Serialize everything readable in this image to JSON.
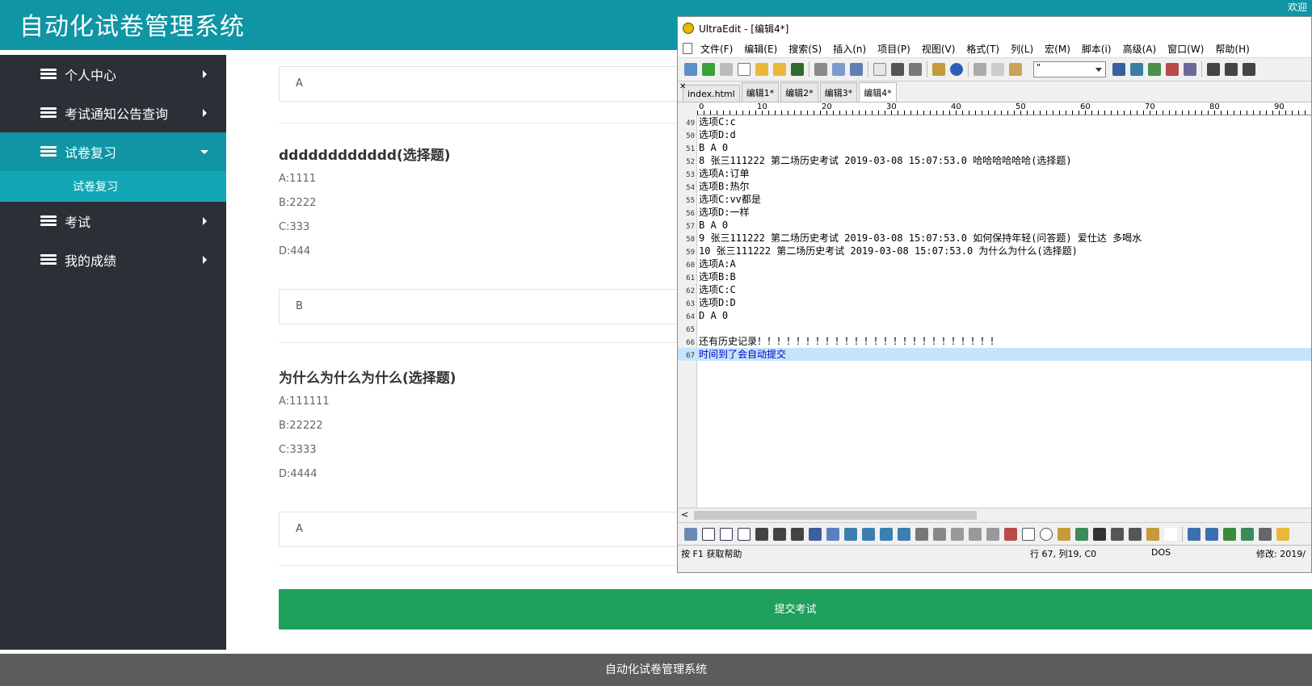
{
  "header": {
    "title": "自动化试卷管理系统",
    "welcome": "欢迎"
  },
  "sidebar": {
    "items": [
      {
        "label": "个人中心"
      },
      {
        "label": "考试通知公告查询"
      },
      {
        "label": "试卷复习",
        "sub": "试卷复习"
      },
      {
        "label": "考试"
      },
      {
        "label": "我的成绩"
      }
    ]
  },
  "exam": {
    "answer1": "A",
    "q2": {
      "title": "dddddddddddd(选择题)",
      "options": [
        "A:1111",
        "B:2222",
        "C:333",
        "D:444"
      ],
      "answer": "B"
    },
    "q3": {
      "title": "为什么为什么为什么(选择题)",
      "options": [
        "A:111111",
        "B:22222",
        "C:3333",
        "D:4444"
      ],
      "answer": "A"
    },
    "submit_label": "提交考试"
  },
  "footer": {
    "text": "自动化试卷管理系统"
  },
  "ultraedit": {
    "title": "UltraEdit - [编辑4*]",
    "menu": [
      "文件(F)",
      "编辑(E)",
      "搜索(S)",
      "插入(n)",
      "项目(P)",
      "视图(V)",
      "格式(T)",
      "列(L)",
      "宏(M)",
      "脚本(i)",
      "高级(A)",
      "窗口(W)",
      "帮助(H)"
    ],
    "font_select": "\"",
    "tabs": [
      "index.html",
      "编辑1*",
      "编辑2*",
      "编辑3*",
      "编辑4*"
    ],
    "ruler": [
      "0",
      "10",
      "20",
      "30",
      "40",
      "50",
      "60",
      "70",
      "80",
      "90"
    ],
    "lines": [
      {
        "n": "49",
        "t": "选项C:c"
      },
      {
        "n": "50",
        "t": "选项D:d"
      },
      {
        "n": "51",
        "t": "B A 0"
      },
      {
        "n": "52",
        "t": "8 张三111222  第二场历史考试  2019-03-08 15:07:53.0 哈哈哈哈哈哈(选择题)"
      },
      {
        "n": "53",
        "t": "选项A:订单"
      },
      {
        "n": "54",
        "t": "选项B:热尔"
      },
      {
        "n": "55",
        "t": "选项C:vv都是"
      },
      {
        "n": "56",
        "t": "选项D:一样"
      },
      {
        "n": "57",
        "t": "B A 0"
      },
      {
        "n": "58",
        "t": "9 张三111222  第二场历史考试  2019-03-08 15:07:53.0 如何保持年轻(问答题)  爱仕达  多喝水"
      },
      {
        "n": "59",
        "t": "10  张三111222  第二场历史考试  2019-03-08 15:07:53.0 为什么为什么(选择题)"
      },
      {
        "n": "60",
        "t": "选项A:A"
      },
      {
        "n": "61",
        "t": "选项B:B"
      },
      {
        "n": "62",
        "t": "选项C:C"
      },
      {
        "n": "63",
        "t": "选项D:D"
      },
      {
        "n": "64",
        "t": "D A 0"
      },
      {
        "n": "65",
        "t": ""
      },
      {
        "n": "66",
        "t": "还有历史记录！！！！！！！！！！！！！！！！！！！！！！！！！"
      },
      {
        "n": "67",
        "t": "时间到了会自动提交"
      }
    ],
    "status": {
      "help": "按 F1 获取帮助",
      "position": "行 67, 列19, C0",
      "format": "DOS",
      "modified": "修改:  2019/"
    }
  }
}
